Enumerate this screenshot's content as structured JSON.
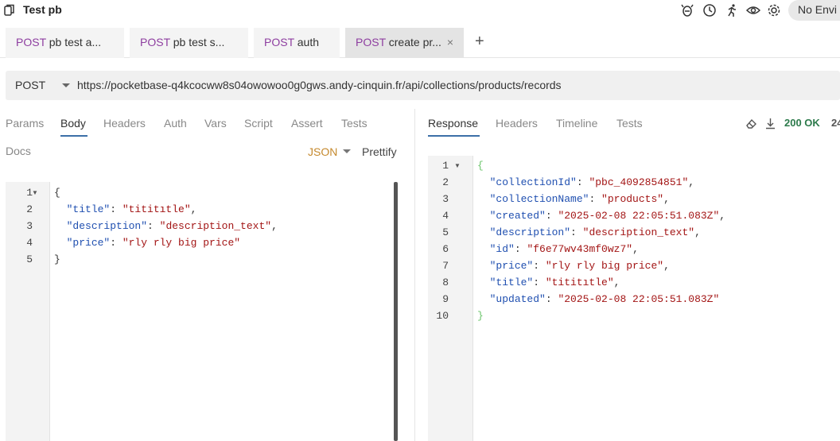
{
  "app": {
    "title": "Test pb",
    "environment": "No Envi"
  },
  "tabs": [
    {
      "method": "POST",
      "label": "pb test a..."
    },
    {
      "method": "POST",
      "label": "pb test s..."
    },
    {
      "method": "POST",
      "label": "auth"
    },
    {
      "method": "POST",
      "label": "create pr...",
      "close": "×"
    }
  ],
  "tab_add": "+",
  "url": {
    "method": "POST",
    "value": "https://pocketbase-q4kcocww8s04owowoo0g0gws.andy-cinquin.fr/api/collections/products/records"
  },
  "request": {
    "tabs": [
      "Params",
      "Body",
      "Headers",
      "Auth",
      "Vars",
      "Script",
      "Assert",
      "Tests"
    ],
    "active_tab": "Body",
    "docs": "Docs",
    "format": "JSON",
    "prettify": "Prettify",
    "line_numbers": [
      "1",
      "2",
      "3",
      "4",
      "5"
    ],
    "body_lines": [
      {
        "open": "{"
      },
      {
        "key": "\"title\"",
        "val": "\"tititıtle\""
      },
      {
        "key": "\"description\"",
        "val": "\"description_text\""
      },
      {
        "key": "\"price\"",
        "val": "\"rly rly big price\""
      },
      {
        "close": "}"
      }
    ]
  },
  "response": {
    "tabs": [
      "Response",
      "Headers",
      "Timeline",
      "Tests"
    ],
    "active_tab": "Response",
    "status": "200 OK",
    "size_cut": "24",
    "line_numbers": [
      "1",
      "2",
      "3",
      "4",
      "5",
      "6",
      "7",
      "8",
      "9",
      "10"
    ],
    "lines": [
      {
        "open": "{"
      },
      {
        "key": "\"collectionId\"",
        "val": "\"pbc_4092854851\""
      },
      {
        "key": "\"collectionName\"",
        "val": "\"products\""
      },
      {
        "key": "\"created\"",
        "val": "\"2025-02-08 22:05:51.083Z\""
      },
      {
        "key": "\"description\"",
        "val": "\"description_text\""
      },
      {
        "key": "\"id\"",
        "val": "\"f6e77wv43mf0wz7\""
      },
      {
        "key": "\"price\"",
        "val": "\"rly rly big price\""
      },
      {
        "key": "\"title\"",
        "val": "\"tititıtle\""
      },
      {
        "key": "\"updated\"",
        "val": "\"2025-02-08 22:05:51.083Z\"",
        "last": true
      },
      {
        "close": "}"
      }
    ]
  },
  "icons": [
    "app-icon",
    "bug-icon",
    "clock-icon",
    "runner-icon",
    "eye-icon",
    "gear-icon",
    "eraser-icon",
    "download-icon"
  ]
}
